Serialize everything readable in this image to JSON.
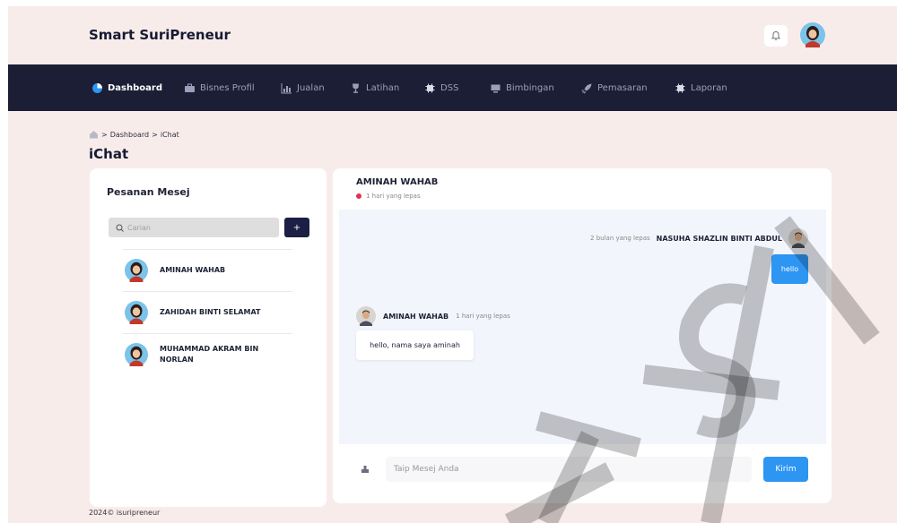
{
  "brand": "Smart SuriPreneur",
  "nav": [
    {
      "label": "Dashboard",
      "icon": "pie-chart-icon",
      "active": true
    },
    {
      "label": "Bisnes Profil",
      "icon": "briefcase-icon"
    },
    {
      "label": "Jualan",
      "icon": "bar-chart-icon"
    },
    {
      "label": "Latihan",
      "icon": "trophy-icon"
    },
    {
      "label": "DSS",
      "icon": "chip-icon"
    },
    {
      "label": "Bimbingan",
      "icon": "monitor-icon"
    },
    {
      "label": "Pemasaran",
      "icon": "rocket-icon"
    },
    {
      "label": "Laporan",
      "icon": "chip-icon"
    }
  ],
  "breadcrumb": {
    "sep": ">",
    "items": [
      "Dashboard",
      "iChat"
    ]
  },
  "page_title": "iChat",
  "left_panel": {
    "title": "Pesanan Mesej",
    "search_placeholder": "Carian",
    "add_label": "+",
    "contacts": [
      {
        "name": "AMINAH WAHAB"
      },
      {
        "name": "ZAHIDAH BINTI SELAMAT"
      },
      {
        "name": "MUHAMMAD AKRAM BIN NORLAN"
      }
    ]
  },
  "chat": {
    "name": "AMINAH WAHAB",
    "status": "1 hari yang lepas",
    "outgoing": {
      "time": "2 bulan yang lepas",
      "sender": "NASUHA SHAZLIN BINTI ABDUL",
      "text": "hello"
    },
    "incoming": {
      "sender": "AMINAH WAHAB",
      "time": "1 hari yang lepas",
      "text": "hello, nama saya aminah"
    },
    "input_placeholder": "Taip Mesej Anda",
    "send_label": "Kirim"
  },
  "footer": "2024© isuripreneur",
  "watermark": "UTSM",
  "colors": {
    "nav_bg": "#1b1e35",
    "accent": "#2d95f2",
    "page_bg": "#f8ecea",
    "status_dot": "#e2334b"
  }
}
